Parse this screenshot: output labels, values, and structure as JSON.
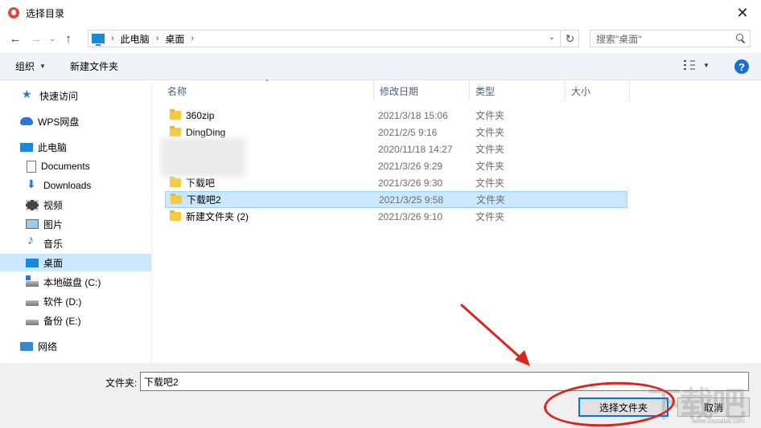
{
  "window": {
    "title": "选择目录",
    "close_glyph": "✕"
  },
  "address_bar": {
    "breadcrumbs": [
      "此电脑",
      "桌面"
    ],
    "search_placeholder": "搜索\"桌面\""
  },
  "toolbar": {
    "organize_label": "组织",
    "new_folder_label": "新建文件夹",
    "help_glyph": "?"
  },
  "navigation": {
    "items": [
      {
        "label": "快速访问",
        "icon": "star-icon"
      },
      {
        "label": "WPS网盘",
        "icon": "cloud-icon"
      },
      {
        "label": "此电脑",
        "icon": "computer-icon"
      },
      {
        "label": "Documents",
        "icon": "document-icon"
      },
      {
        "label": "Downloads",
        "icon": "download-icon"
      },
      {
        "label": "视频",
        "icon": "video-icon"
      },
      {
        "label": "图片",
        "icon": "picture-icon"
      },
      {
        "label": "音乐",
        "icon": "music-icon"
      },
      {
        "label": "桌面",
        "icon": "desktop-icon",
        "selected": true
      },
      {
        "label": "本地磁盘 (C:)",
        "icon": "drive-icon"
      },
      {
        "label": "软件 (D:)",
        "icon": "drive-icon"
      },
      {
        "label": "备份 (E:)",
        "icon": "drive-icon"
      },
      {
        "label": "网络",
        "icon": "network-icon"
      }
    ]
  },
  "columns": {
    "name": "名称",
    "date": "修改日期",
    "type": "类型",
    "size": "大小"
  },
  "files": [
    {
      "name": "360zip",
      "date": "2021/3/18 15:06",
      "type": "文件夹"
    },
    {
      "name": "DingDing",
      "date": "2021/2/5 9:16",
      "type": "文件夹"
    },
    {
      "name": "",
      "date": "2020/11/18 14:27",
      "type": "文件夹",
      "obscured": true
    },
    {
      "name": "",
      "date": "2021/3/26 9:29",
      "type": "文件夹",
      "obscured": true
    },
    {
      "name": "下载吧",
      "date": "2021/3/26 9:30",
      "type": "文件夹"
    },
    {
      "name": "下载吧2",
      "date": "2021/3/25 9:58",
      "type": "文件夹",
      "selected": true
    },
    {
      "name": "新建文件夹 (2)",
      "date": "2021/3/26 9:10",
      "type": "文件夹"
    }
  ],
  "footer": {
    "folder_label": "文件夹:",
    "folder_value": "下载吧2",
    "select_button": "选择文件夹",
    "cancel_button": "取消"
  },
  "watermark": {
    "text": "下载吧",
    "url": "www.xiazaiba.com"
  },
  "colors": {
    "selection": "#cce8ff",
    "annotation": "#d9261c",
    "accent": "#0078d7"
  }
}
